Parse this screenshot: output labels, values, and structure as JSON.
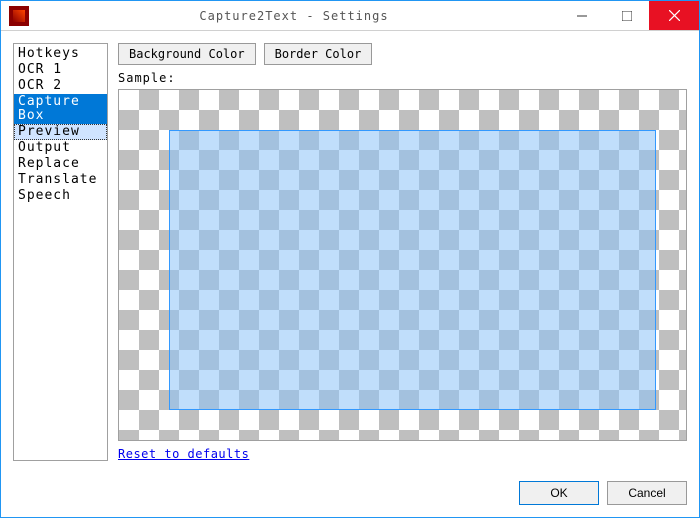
{
  "window": {
    "title": "Capture2Text - Settings"
  },
  "sidebar": {
    "items": [
      {
        "label": "Hotkeys"
      },
      {
        "label": "OCR 1"
      },
      {
        "label": "OCR 2"
      },
      {
        "label": "Capture Box"
      },
      {
        "label": "Preview"
      },
      {
        "label": "Output"
      },
      {
        "label": "Replace"
      },
      {
        "label": "Translate"
      },
      {
        "label": "Speech"
      }
    ],
    "selected_index": 3,
    "focused_index": 4
  },
  "main": {
    "bg_color_label": "Background Color",
    "border_color_label": "Border Color",
    "sample_label": "Sample:",
    "reset_label": "Reset to defaults",
    "capture_box_bg": "rgba(141,195,247,0.55)",
    "capture_box_border": "#3399ff"
  },
  "footer": {
    "ok_label": "OK",
    "cancel_label": "Cancel"
  }
}
